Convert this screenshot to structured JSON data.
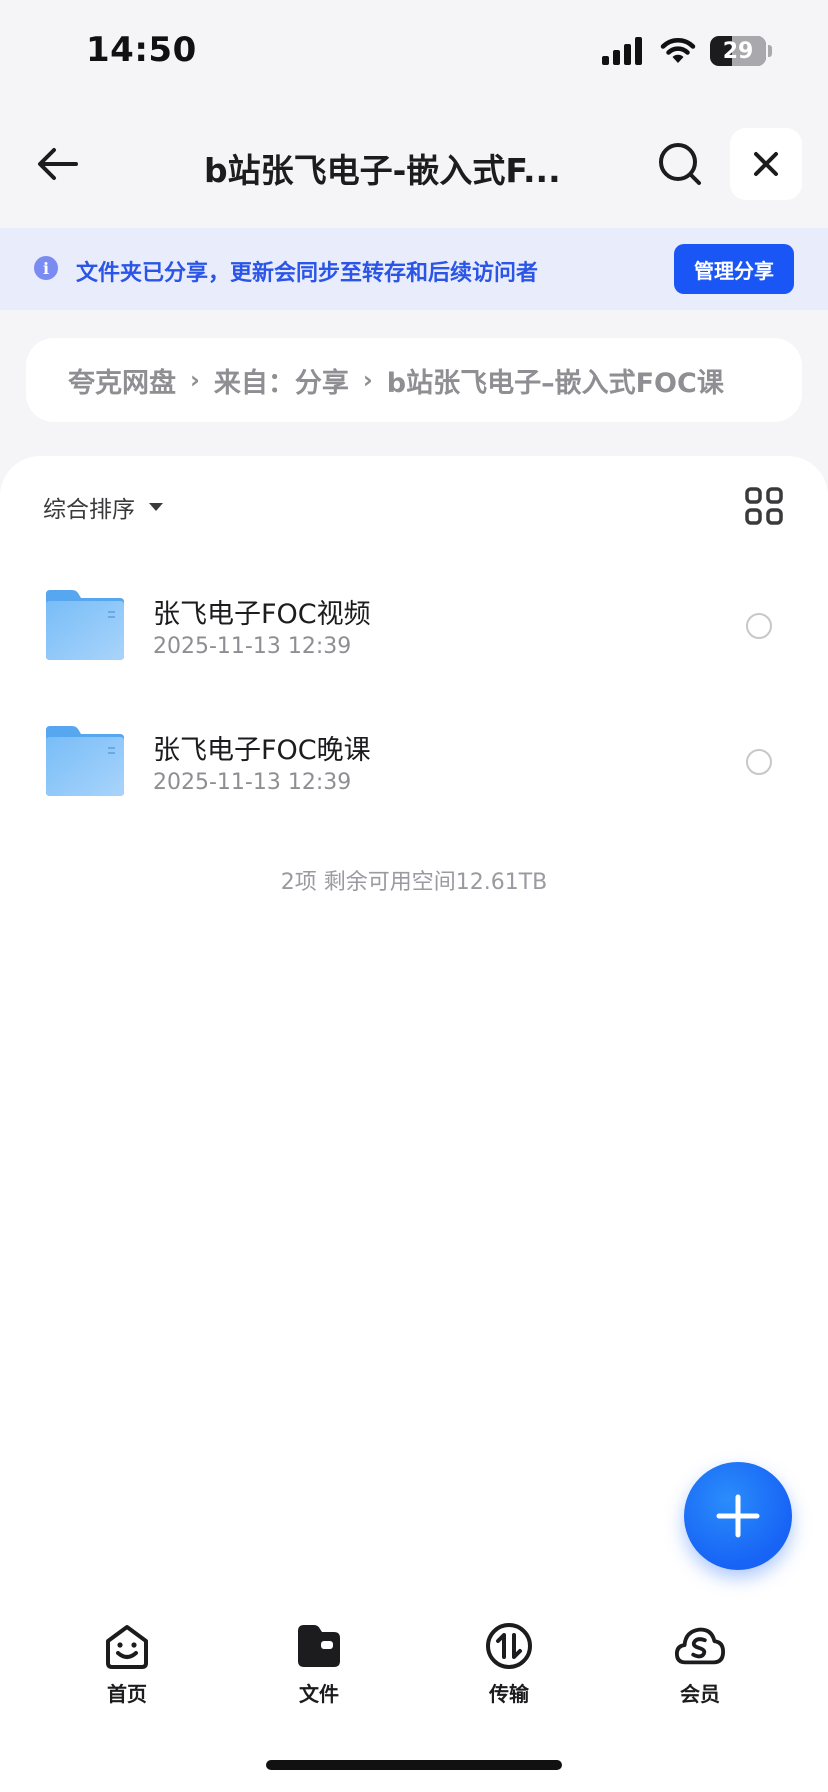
{
  "status_bar": {
    "time": "14:50",
    "battery": "29"
  },
  "nav": {
    "title": "b站张飞电子-嵌入式F..."
  },
  "banner": {
    "text": "文件夹已分享，更新会同步至转存和后续访问者",
    "manage_label": "管理分享"
  },
  "breadcrumb": {
    "items": [
      "夸克网盘",
      "来自：分享",
      "b站张飞电子–嵌入式FOC课"
    ]
  },
  "toolbar": {
    "sort_label": "综合排序"
  },
  "files": [
    {
      "name": "张飞电子FOC视频",
      "date": "2025-11-13 12:39"
    },
    {
      "name": "张飞电子FOC晚课",
      "date": "2025-11-13 12:39"
    }
  ],
  "summary": "2项 剩余可用空间12.61TB",
  "tabs": [
    {
      "label": "首页",
      "icon": "home-smile-icon"
    },
    {
      "label": "文件",
      "icon": "folder-icon"
    },
    {
      "label": "传输",
      "icon": "transfer-icon"
    },
    {
      "label": "会员",
      "icon": "vip-cloud-icon"
    }
  ],
  "colors": {
    "accent": "#1a55f5",
    "banner_bg": "#e9ecfa",
    "banner_text": "#2b55e6",
    "folder": "#6cb4f5"
  }
}
